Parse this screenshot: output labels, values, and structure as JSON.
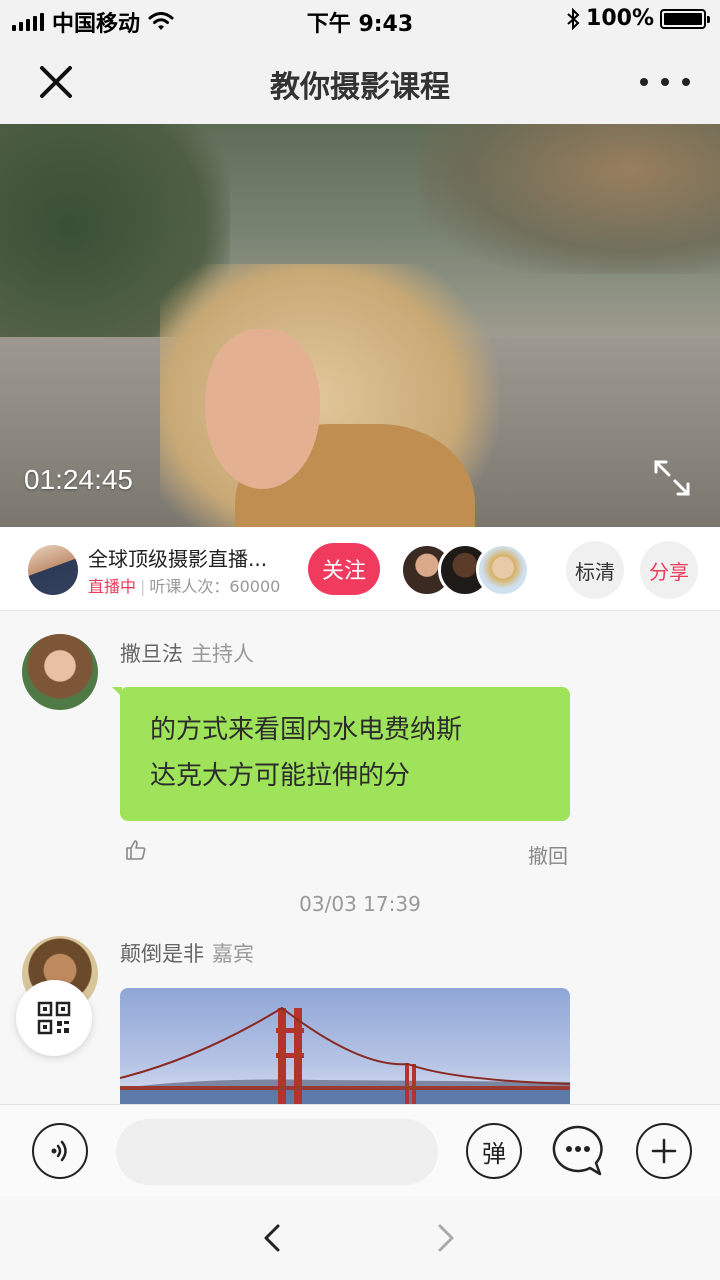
{
  "status_bar": {
    "carrier": "中国移动",
    "time": "下午 9:43",
    "battery": "100%",
    "battery_level": 1.0
  },
  "nav": {
    "title": "教你摄影课程",
    "close_icon": "close-icon",
    "more_icon": "more-icon"
  },
  "video": {
    "timecode": "01:24:45",
    "fullscreen_icon": "fullscreen-icon"
  },
  "course": {
    "name": "全球顶级摄影直播...",
    "status": "直播中",
    "separator": "|",
    "views_label": "听课人次：60000",
    "follow_label": "关注",
    "quality_label": "标清",
    "share_label": "分享"
  },
  "messages": [
    {
      "name": "撒旦法",
      "role": "主持人",
      "text_line1": "的方式来看国内水电费纳斯",
      "text_line2": "达克大方可能拉伸的分",
      "recall_label": "撤回"
    },
    {
      "name": "颠倒是非",
      "role": "嘉宾"
    }
  ],
  "timestamp": "03/03  17:39",
  "toolbar": {
    "danmaku_label": "弹",
    "input_placeholder": ""
  },
  "colors": {
    "accent": "#f03a5e",
    "bubble": "#9ee35a"
  }
}
